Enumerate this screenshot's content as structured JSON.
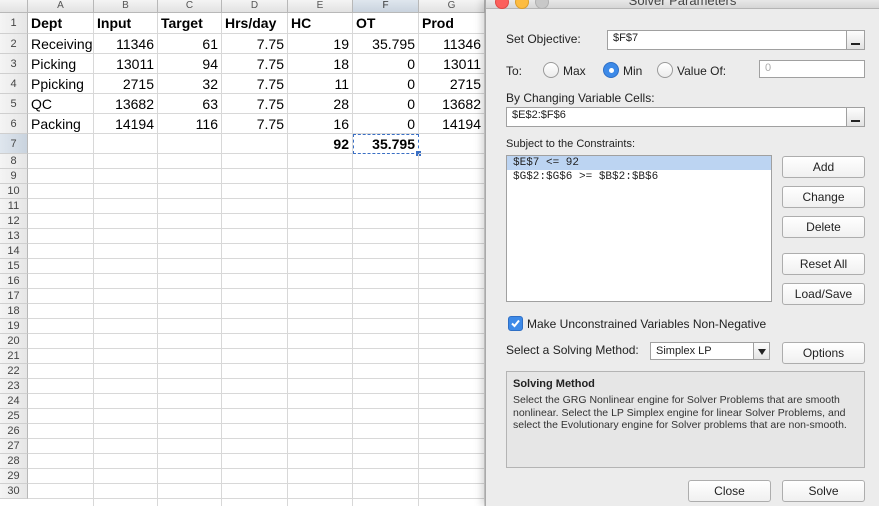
{
  "sheet": {
    "columns": [
      "A",
      "B",
      "C",
      "D",
      "E",
      "F",
      "G"
    ],
    "row_numbers": [
      "1",
      "2",
      "3",
      "4",
      "5",
      "6",
      "7",
      "8",
      "9",
      "10",
      "11",
      "12",
      "13",
      "14",
      "15",
      "16",
      "17",
      "18",
      "19",
      "20",
      "21",
      "22",
      "23",
      "24",
      "25",
      "26",
      "27",
      "28",
      "29",
      "30"
    ],
    "headers": [
      "Dept",
      "Input",
      "Target",
      "Hrs/day",
      "HC",
      "OT",
      "Prod"
    ],
    "rows": [
      [
        "Receiving",
        "11346",
        "61",
        "7.75",
        "19",
        "35.795",
        "11346"
      ],
      [
        "Picking",
        "13011",
        "94",
        "7.75",
        "18",
        "0",
        "13011"
      ],
      [
        "Ppicking",
        "2715",
        "32",
        "7.75",
        "11",
        "0",
        "2715"
      ],
      [
        "QC",
        "13682",
        "63",
        "7.75",
        "28",
        "0",
        "13682"
      ],
      [
        "Packing",
        "14194",
        "116",
        "7.75",
        "16",
        "0",
        "14194"
      ]
    ],
    "totals": {
      "hc": "92",
      "ot": "35.795"
    }
  },
  "dialog": {
    "title": "Solver Parameters",
    "set_objective_label": "Set Objective:",
    "set_objective_value": "$F$7",
    "to_label": "To:",
    "option_max": "Max",
    "option_min": "Min",
    "option_value_of": "Value Of:",
    "value_of_input": "0",
    "changing_cells_label": "By Changing Variable Cells:",
    "changing_cells_value": "$E$2:$F$6",
    "constraints_label": "Subject to the Constraints:",
    "constraints": [
      "$E$7 <= 92",
      "$G$2:$G$6 >= $B$2:$B$6"
    ],
    "buttons": {
      "add": "Add",
      "change": "Change",
      "delete": "Delete",
      "reset_all": "Reset All",
      "load_save": "Load/Save",
      "options": "Options",
      "close": "Close",
      "solve": "Solve"
    },
    "make_nonneg_label": "Make Unconstrained Variables Non-Negative",
    "solving_method_label": "Select a Solving Method:",
    "solving_method_value": "Simplex LP",
    "solving_method_title": "Solving Method",
    "solving_method_text": "Select the GRG Nonlinear engine for Solver Problems that are smooth nonlinear. Select the LP Simplex engine for linear Solver Problems, and select the Evolutionary engine for Solver problems that are non-smooth."
  },
  "colors": {
    "accent": "#3d8ae8",
    "selection": "#bcd4f2",
    "close_btn": "#fc605c",
    "min_btn": "#fdbc40",
    "zoom_btn": "#c8c8c8"
  }
}
